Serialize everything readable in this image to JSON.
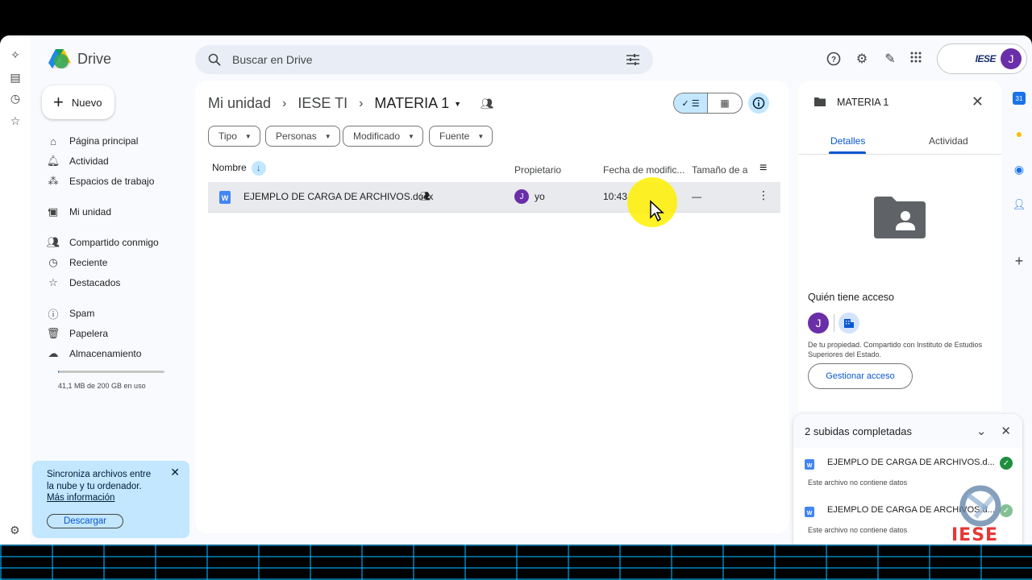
{
  "app": {
    "title": "Drive"
  },
  "search": {
    "placeholder": "Buscar en Drive"
  },
  "account": {
    "org": "IESE",
    "initial": "J"
  },
  "sidebar": {
    "new_label": "Nuevo",
    "items": [
      {
        "label": "Página principal",
        "icon": "home-icon"
      },
      {
        "label": "Actividad",
        "icon": "bell-icon"
      },
      {
        "label": "Espacios de trabajo",
        "icon": "workspaces-icon"
      },
      {
        "label": "Mi unidad",
        "icon": "drive-icon"
      },
      {
        "label": "Compartido conmigo",
        "icon": "people-icon"
      },
      {
        "label": "Reciente",
        "icon": "clock-icon"
      },
      {
        "label": "Destacados",
        "icon": "star-icon"
      },
      {
        "label": "Spam",
        "icon": "spam-icon"
      },
      {
        "label": "Papelera",
        "icon": "trash-icon"
      },
      {
        "label": "Almacenamiento",
        "icon": "cloud-icon"
      }
    ],
    "storage_text": "41,1 MB de 200 GB en uso",
    "storage_fraction": 0.0002
  },
  "sync_card": {
    "text": "Sincroniza archivos entre la nube y tu ordenador.",
    "link": "Más información",
    "button": "Descargar"
  },
  "breadcrumb": {
    "root": "Mi unidad",
    "middle": "IESE TI",
    "current": "MATERIA 1"
  },
  "filters": [
    "Tipo",
    "Personas",
    "Modificado",
    "Fuente"
  ],
  "table": {
    "headers": {
      "name": "Nombre",
      "owner": "Propietario",
      "modified": "Fecha de modific...",
      "size": "Tamaño de a"
    },
    "rows": [
      {
        "name": "EJEMPLO DE CARGA DE ARCHIVOS.docx",
        "owner_initial": "J",
        "owner": "yo",
        "modified": "10:43",
        "size": "—"
      }
    ]
  },
  "details": {
    "title": "MATERIA 1",
    "tabs": [
      "Detalles",
      "Actividad"
    ],
    "access_title": "Quién tiene acceso",
    "access_initial": "J",
    "access_desc": "De tu propiedad. Compartido con Instituto de Estudios Superiores del Estado.",
    "manage_button": "Gestionar acceso"
  },
  "uploads": {
    "title": "2 subidas completadas",
    "items": [
      {
        "name": "EJEMPLO DE CARGA DE ARCHIVOS.d...",
        "sub": "Este archivo no contiene datos"
      },
      {
        "name": "EJEMPLO DE CARGA DE ARCHIVOS.d...",
        "sub": "Este archivo no contiene datos"
      }
    ]
  },
  "watermark": {
    "text": "IESE"
  },
  "colors": {
    "accent": "#0b57d0",
    "selected_bg": "#c2e7ff",
    "avatar": "#6a2ea8",
    "success": "#1e8e3e"
  }
}
